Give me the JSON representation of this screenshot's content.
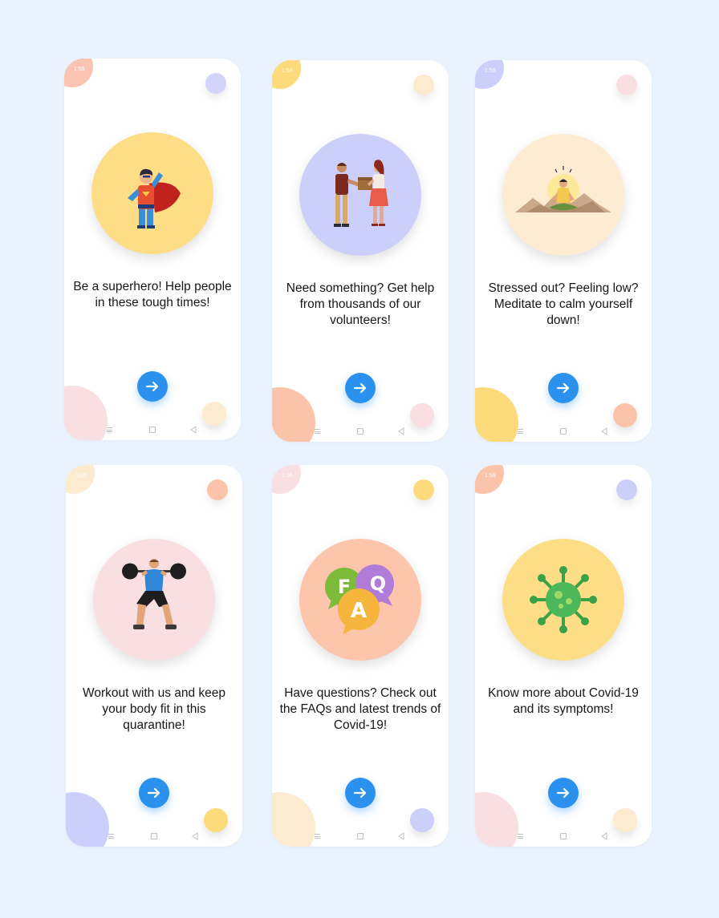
{
  "screens": [
    {
      "status_time": "1:56",
      "caption": "Be a superhero! Help people in these tough times!",
      "hero_icon": "superhero-icon",
      "hero_color": "#fddd85",
      "status_blob_color": "#fbc3b1",
      "corner_dot_color": "#d4d4fb",
      "bottom_blob_color": "#f9dfe2",
      "bottom_dot_color": "#fdebd0"
    },
    {
      "status_time": "1:56",
      "caption": "Need something? Get help from thousands of our volunteers!",
      "hero_icon": "volunteers-icon",
      "hero_color": "#cdcffb",
      "status_blob_color": "#fddb7d",
      "corner_dot_color": "#fdebd0",
      "bottom_blob_color": "#fbc3aa",
      "bottom_dot_color": "#f9dfe2"
    },
    {
      "status_time": "1:56",
      "caption": "Stressed out? Feeling low? Meditate to calm yourself down!",
      "hero_icon": "meditation-icon",
      "hero_color": "#fdebd2",
      "status_blob_color": "#cdcffb",
      "corner_dot_color": "#f9dfe2",
      "bottom_blob_color": "#fddb7d",
      "bottom_dot_color": "#fbc3aa"
    },
    {
      "status_time": "1:56",
      "caption": "Workout with us and keep your body fit in this quarantine!",
      "hero_icon": "workout-icon",
      "hero_color": "#f9dfe2",
      "status_blob_color": "#fdebd0",
      "corner_dot_color": "#fbc3aa",
      "bottom_blob_color": "#cdcffb",
      "bottom_dot_color": "#fddb7d"
    },
    {
      "status_time": "1:56",
      "caption": "Have questions? Check out the FAQs and latest trends of Covid-19!",
      "hero_icon": "faq-icon",
      "hero_color": "#fcc5ac",
      "status_blob_color": "#f9dfe2",
      "corner_dot_color": "#fddb7d",
      "bottom_blob_color": "#fdebd0",
      "bottom_dot_color": "#cdcffb"
    },
    {
      "status_time": "1:56",
      "caption": "Know more about Covid-19 and its symptoms!",
      "hero_icon": "virus-icon",
      "hero_color": "#fddd85",
      "status_blob_color": "#fbc3aa",
      "corner_dot_color": "#cdcffb",
      "bottom_blob_color": "#f9dfe2",
      "bottom_dot_color": "#fdebd0"
    }
  ],
  "faq_letters": [
    "F",
    "Q",
    "A"
  ],
  "accent_color": "#2a92ee",
  "background_color": "#eaf3fd"
}
